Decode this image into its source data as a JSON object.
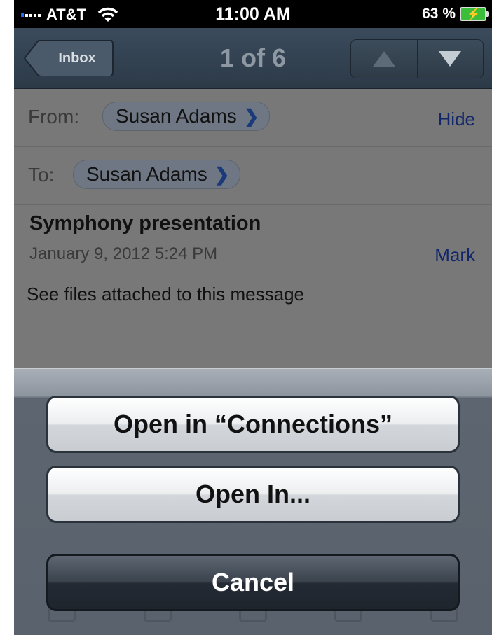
{
  "status_bar": {
    "carrier": "AT&T",
    "time": "11:00 AM",
    "battery": "63 %",
    "icons": [
      "signal-icon",
      "wifi-icon",
      "battery-icon"
    ]
  },
  "nav": {
    "back_label": "Inbox",
    "title": "1 of 6",
    "prev_icon": "up-arrow-icon",
    "next_icon": "down-arrow-icon"
  },
  "email": {
    "from_label": "From:",
    "from_name": "Susan Adams",
    "hide_link": "Hide",
    "to_label": "To:",
    "to_name": "Susan Adams",
    "subject": "Symphony presentation",
    "date": "January 9, 2012 5:24 PM",
    "mark_link": "Mark",
    "body": "See files attached to this message"
  },
  "action_sheet": {
    "open_connections": "Open in “Connections”",
    "open_in": "Open In...",
    "cancel": "Cancel"
  }
}
